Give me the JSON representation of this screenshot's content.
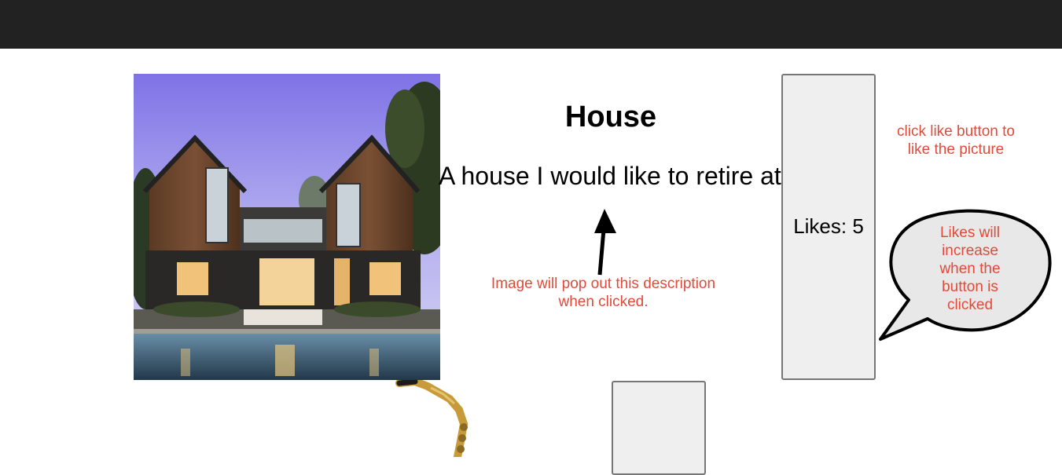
{
  "post": {
    "title": "House",
    "description": "A house I would like to retire at."
  },
  "like_button": {
    "label": "Likes: 5",
    "count": 5
  },
  "annotations": {
    "image_note": "Image will pop out this description when clicked.",
    "like_note": "click like button to like the picture",
    "bubble_note": "Likes will increase when the button is clicked"
  },
  "images": {
    "house_photo": "house-photo",
    "saxophone_photo": "saxophone-image"
  },
  "colors": {
    "topbar": "#222222",
    "annotation_red": "#e04a3a",
    "button_bg": "#efefef"
  }
}
